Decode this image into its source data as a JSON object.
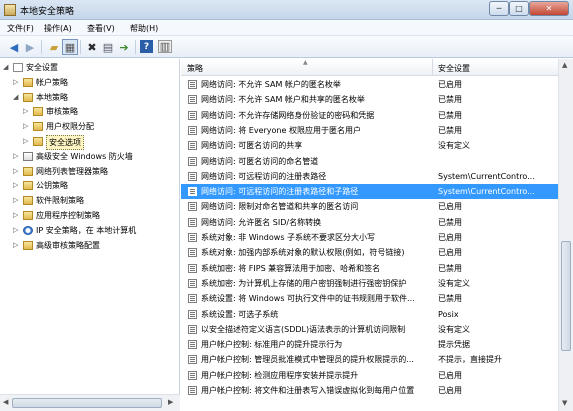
{
  "window": {
    "title": "本地安全策略",
    "min_label": "─",
    "max_label": "□",
    "close_label": "✕"
  },
  "menu": [
    "文件(F)",
    "操作(A)",
    "查看(V)",
    "帮助(H)"
  ],
  "toolbar": {
    "icons": [
      "back-icon",
      "forward-icon",
      "up-folder-icon",
      "show-tree-icon",
      "delete-icon",
      "properties-icon",
      "export-list-icon",
      "help-icon",
      "action-pane-icon"
    ]
  },
  "tree": {
    "items": [
      {
        "label": "安全设置",
        "level": 0,
        "icon": "policy-icon",
        "expanded": true
      },
      {
        "label": "帐户策略",
        "level": 1,
        "icon": "folder-icon",
        "expanded": false
      },
      {
        "label": "本地策略",
        "level": 1,
        "icon": "folder-icon",
        "expanded": true
      },
      {
        "label": "审核策略",
        "level": 2,
        "icon": "folder-icon",
        "expanded": false
      },
      {
        "label": "用户权限分配",
        "level": 2,
        "icon": "folder-icon",
        "expanded": false
      },
      {
        "label": "安全选项",
        "level": 2,
        "icon": "folder-icon",
        "expanded": false,
        "selected": true
      },
      {
        "label": "高级安全 Windows 防火墙",
        "level": 1,
        "icon": "security-icon",
        "expanded": false
      },
      {
        "label": "网络列表管理器策略",
        "level": 1,
        "icon": "folder-icon",
        "expanded": false
      },
      {
        "label": "公钥策略",
        "level": 1,
        "icon": "folder-icon",
        "expanded": false
      },
      {
        "label": "软件限制策略",
        "level": 1,
        "icon": "folder-icon",
        "expanded": false
      },
      {
        "label": "应用程序控制策略",
        "level": 1,
        "icon": "folder-icon",
        "expanded": false
      },
      {
        "label": "IP 安全策略，在 本地计算机",
        "level": 1,
        "icon": "ip-icon",
        "expanded": false
      },
      {
        "label": "高级审核策略配置",
        "level": 1,
        "icon": "folder-icon",
        "expanded": false
      }
    ]
  },
  "list": {
    "columns": [
      "策略",
      "安全设置"
    ],
    "rows": [
      {
        "name": "网络访问: 不允许 SAM 帐户的匿名枚举",
        "setting": "已启用"
      },
      {
        "name": "网络访问: 不允许 SAM 帐户和共享的匿名枚举",
        "setting": "已禁用"
      },
      {
        "name": "网络访问: 不允许存储网络身份验证的密码和凭据",
        "setting": "已禁用"
      },
      {
        "name": "网络访问: 将 Everyone 权限应用于匿名用户",
        "setting": "已禁用"
      },
      {
        "name": "网络访问: 可匿名访问的共享",
        "setting": "没有定义"
      },
      {
        "name": "网络访问: 可匿名访问的命名管道",
        "setting": ""
      },
      {
        "name": "网络访问: 可远程访问的注册表路径",
        "setting": "System\\CurrentContro..."
      },
      {
        "name": "网络访问: 可远程访问的注册表路径和子路径",
        "setting": "System\\CurrentContro...",
        "selected": true
      },
      {
        "name": "网络访问: 限制对命名管道和共享的匿名访问",
        "setting": "已启用"
      },
      {
        "name": "网络访问: 允许匿名 SID/名称转换",
        "setting": "已禁用"
      },
      {
        "name": "系统对象: 非 Windows 子系统不要求区分大小写",
        "setting": "已启用"
      },
      {
        "name": "系统对象: 加强内部系统对象的默认权限(例如，符号链接)",
        "setting": "已启用"
      },
      {
        "name": "系统加密: 将 FIPS 兼容算法用于加密、哈希和签名",
        "setting": "已禁用"
      },
      {
        "name": "系统加密: 为计算机上存储的用户密钥强制进行强密钥保护",
        "setting": "没有定义"
      },
      {
        "name": "系统设置: 将 Windows 可执行文件中的证书规则用于软件...",
        "setting": "已禁用"
      },
      {
        "name": "系统设置: 可选子系统",
        "setting": "Posix"
      },
      {
        "name": "以安全描述符定义语言(SDDL)语法表示的计算机访问限制",
        "setting": "没有定义"
      },
      {
        "name": "用户帐户控制: 标准用户的提升提示行为",
        "setting": "提示凭据"
      },
      {
        "name": "用户帐户控制: 管理员批准模式中管理员的提升权限提示的...",
        "setting": "不提示，直接提升"
      },
      {
        "name": "用户帐户控制: 检测应用程序安装并提示提升",
        "setting": "已启用"
      },
      {
        "name": "用户帐户控制: 将文件和注册表写入错误虚拟化到每用户位置",
        "setting": "已启用"
      }
    ]
  }
}
